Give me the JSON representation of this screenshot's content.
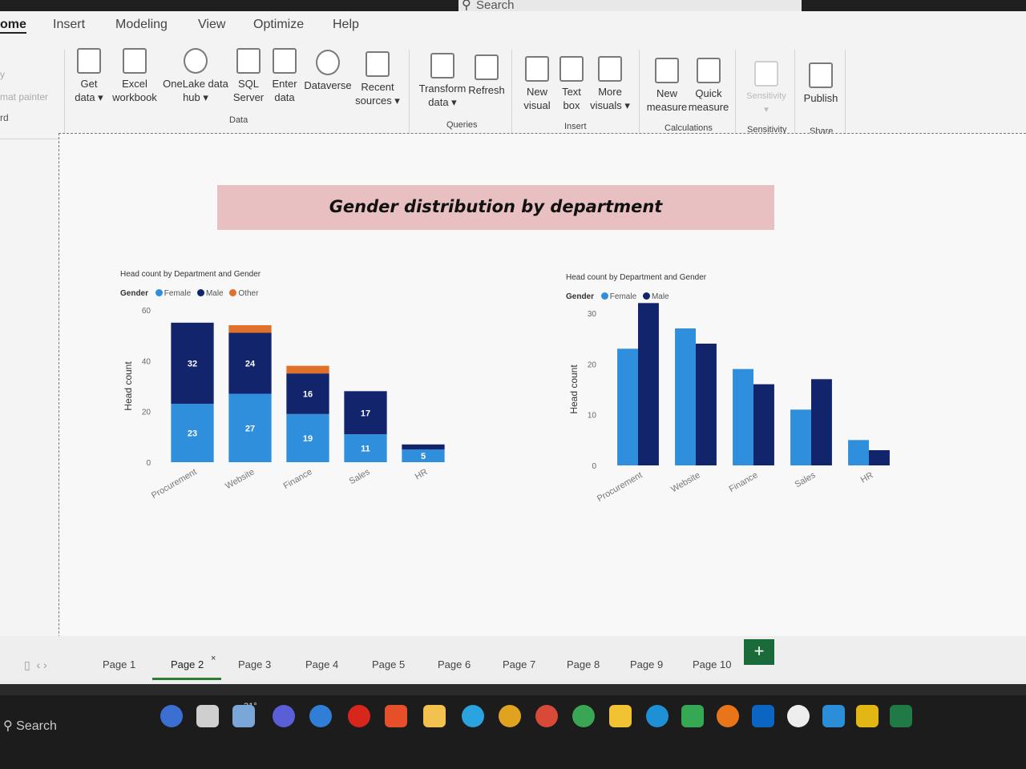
{
  "menubar": {
    "search_placeholder": "Search",
    "items": [
      "ome",
      "Insert",
      "Modeling",
      "View",
      "Optimize",
      "Help"
    ]
  },
  "ribbon": {
    "left_fragments": [
      "y",
      "mat painter",
      "rd"
    ],
    "buttons": {
      "get_data": [
        "Get",
        "data ▾"
      ],
      "excel": [
        "Excel",
        "workbook"
      ],
      "onelake": [
        "OneLake data",
        "hub ▾"
      ],
      "sql": [
        "SQL",
        "Server"
      ],
      "enter": [
        "Enter",
        "data"
      ],
      "dataverse": [
        "Dataverse",
        ""
      ],
      "recent": [
        "Recent",
        "sources ▾"
      ],
      "transform": [
        "Transform",
        "data ▾"
      ],
      "refresh": [
        "Refresh",
        ""
      ],
      "new_visual": [
        "New",
        "visual"
      ],
      "text_box": [
        "Text",
        "box"
      ],
      "more_visuals": [
        "More",
        "visuals ▾"
      ],
      "new_measure": [
        "New",
        "measure"
      ],
      "quick_measure": [
        "Quick",
        "measure"
      ],
      "sensitivity": [
        "Sensitivity",
        "▾"
      ],
      "publish": [
        "Publish",
        ""
      ]
    },
    "groups": {
      "data": "Data",
      "queries": "Queries",
      "insert": "Insert",
      "calculations": "Calculations",
      "sensitivity": "Sensitivity",
      "share": "Share"
    }
  },
  "report": {
    "banner_title": "Gender distribution by department"
  },
  "chart_data": [
    {
      "type": "bar",
      "stacked": true,
      "title": "Head count by Department and Gender",
      "legend_title": "Gender",
      "legend_position": "top-left",
      "xlabel": "",
      "ylabel": "Head count",
      "ylim": [
        0,
        60
      ],
      "yticks": [
        0,
        20,
        40,
        60
      ],
      "categories": [
        "Procurement",
        "Website",
        "Finance",
        "Sales",
        "HR"
      ],
      "series": [
        {
          "name": "Female",
          "color": "#2f8fdc",
          "values": [
            23,
            27,
            19,
            11,
            5
          ],
          "labels": [
            "23",
            "27",
            "19",
            "11",
            "5"
          ]
        },
        {
          "name": "Male",
          "color": "#12246b",
          "values": [
            32,
            24,
            16,
            17,
            2
          ],
          "labels": [
            "32",
            "24",
            "16",
            "17",
            ""
          ]
        },
        {
          "name": "Other",
          "color": "#e0702a",
          "values": [
            0,
            3,
            3,
            0,
            0
          ],
          "labels": [
            "",
            "",
            "",
            "",
            ""
          ]
        }
      ]
    },
    {
      "type": "bar",
      "stacked": false,
      "title": "Head count by Department and Gender",
      "legend_title": "Gender",
      "legend_position": "top-left",
      "xlabel": "",
      "ylabel": "Head count",
      "ylim": [
        0,
        30
      ],
      "yticks": [
        0,
        10,
        20,
        30
      ],
      "categories": [
        "Procurement",
        "Website",
        "Finance",
        "Sales",
        "HR"
      ],
      "series": [
        {
          "name": "Female",
          "color": "#2f8fdc",
          "values": [
            23,
            27,
            19,
            11,
            5
          ]
        },
        {
          "name": "Male",
          "color": "#12246b",
          "values": [
            32,
            24,
            16,
            17,
            3
          ]
        }
      ]
    }
  ],
  "tabs": {
    "pages": [
      "Page 1",
      "Page 2",
      "Page 3",
      "Page 4",
      "Page 5",
      "Page 6",
      "Page 7",
      "Page 8",
      "Page 9",
      "Page 10"
    ],
    "active_index": 1,
    "close_glyph": "×",
    "add_glyph": "+"
  },
  "taskbar": {
    "search_label": "Search",
    "weather": "31°"
  }
}
